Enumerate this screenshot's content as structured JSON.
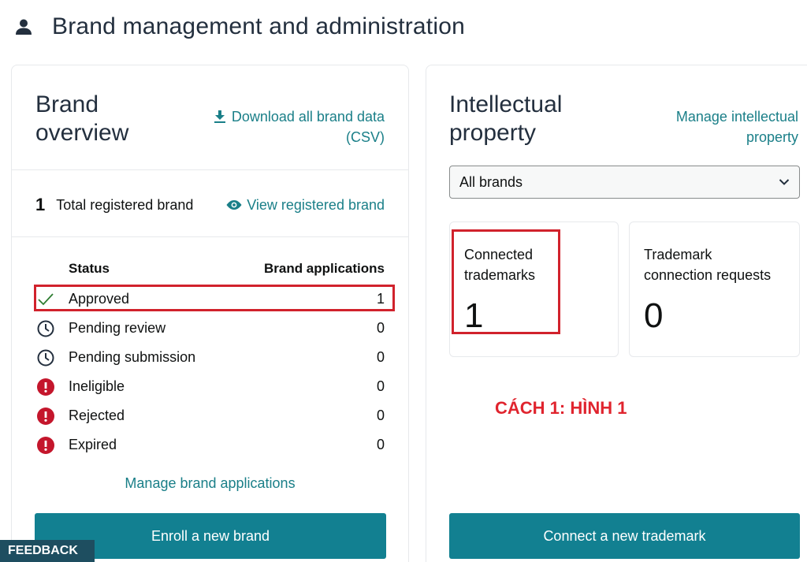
{
  "header": {
    "icon": "user-icon",
    "title": "Brand management and administration"
  },
  "brand_overview": {
    "title": "Brand\noverview",
    "download_link": "Download all brand data (CSV)",
    "total_count": "1",
    "total_label": "Total registered brand",
    "view_link": "View registered brand",
    "status_header": "Status",
    "apps_header": "Brand applications",
    "statuses": [
      {
        "icon": "check-icon",
        "label": "Approved",
        "count": "1"
      },
      {
        "icon": "clock-icon",
        "label": "Pending review",
        "count": "0"
      },
      {
        "icon": "clock-icon",
        "label": "Pending submission",
        "count": "0"
      },
      {
        "icon": "alert-icon",
        "label": "Ineligible",
        "count": "0"
      },
      {
        "icon": "alert-icon",
        "label": "Rejected",
        "count": "0"
      },
      {
        "icon": "alert-icon",
        "label": "Expired",
        "count": "0"
      }
    ],
    "manage_link": "Manage brand applications",
    "enroll_button": "Enroll a new brand"
  },
  "ip": {
    "title": "Intellectual\nproperty",
    "manage_link": "Manage intellectual property",
    "select_value": "All brands",
    "tiles": [
      {
        "label": "Connected\ntrademarks",
        "value": "1"
      },
      {
        "label": "Trademark\nconnection requests",
        "value": "0"
      }
    ],
    "connect_button": "Connect a new trademark"
  },
  "annotation": "CÁCH 1: HÌNH 1",
  "feedback": "FEEDBACK",
  "colors": {
    "accent": "#128091",
    "link": "#1a7f88",
    "highlight": "#d1222c",
    "success": "#2e7d32",
    "error": "#c4162c"
  }
}
